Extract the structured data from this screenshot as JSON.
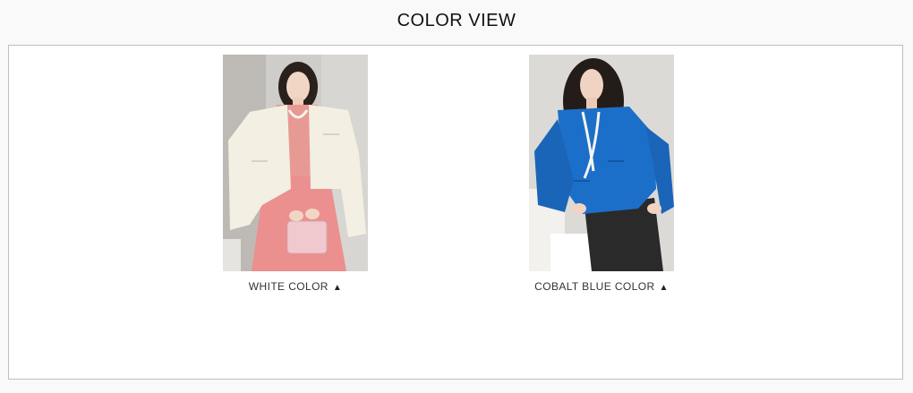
{
  "page": {
    "title": "COLOR VIEW"
  },
  "colors": [
    {
      "label": "WHITE COLOR",
      "arrow": "▲",
      "jacket": "#f3efe2",
      "shirt": "#e79a93",
      "skirt": "#ec8f8f",
      "bg": "#cfcdc9"
    },
    {
      "label": "COBALT BLUE COLOR",
      "arrow": "▲",
      "jacket": "#1c6fc9",
      "shirt": "#1c6fc9",
      "skirt": "#2a2a2a",
      "bg": "#dcdad6"
    }
  ]
}
